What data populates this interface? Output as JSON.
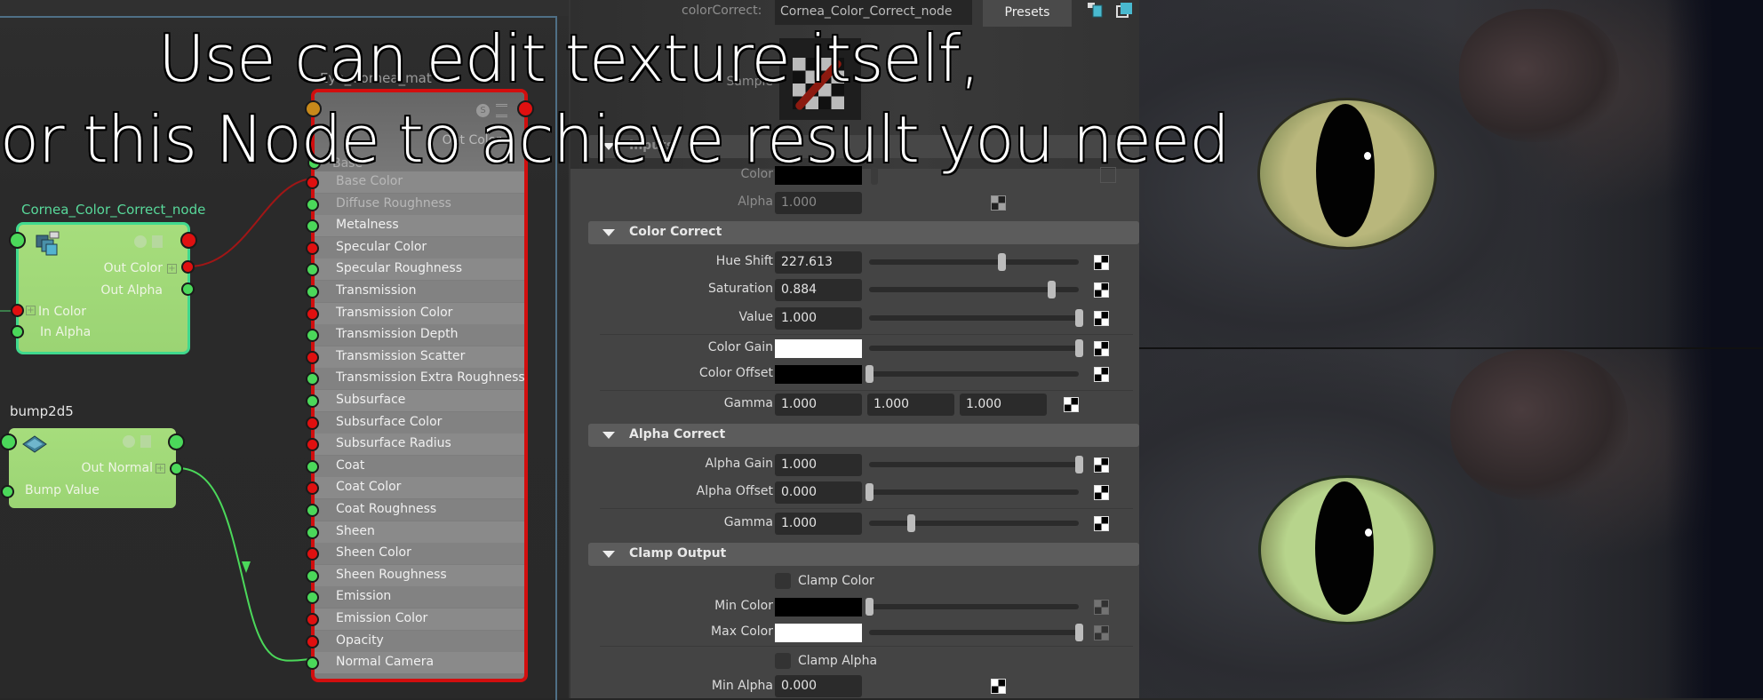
{
  "overlay_caption": {
    "line1": "Use can edit texture itself,",
    "line2": "or this Node to achieve result you need"
  },
  "node_editor": {
    "color_correct_node": {
      "title": "Cornea_Color_Correct_node",
      "icon": "color-correct-node-icon",
      "outputs": [
        "Out Color",
        "Out Alpha"
      ],
      "inputs": [
        "In Color",
        "In Alpha"
      ]
    },
    "bump_node": {
      "title": "bump2d5",
      "icon": "bump-node-icon",
      "outputs": [
        "Out Normal"
      ],
      "inputs": [
        "Bump Value"
      ]
    },
    "material_node": {
      "title": "Eye_Cornea_mat",
      "output_label": "Out Color",
      "first_port_label": "Base",
      "ports": [
        {
          "label": "Base Color",
          "type": "color"
        },
        {
          "label": "Diffuse Roughness",
          "type": "float"
        },
        {
          "label": "Metalness",
          "type": "float"
        },
        {
          "label": "Specular Color",
          "type": "color"
        },
        {
          "label": "Specular Roughness",
          "type": "float"
        },
        {
          "label": "Transmission",
          "type": "float"
        },
        {
          "label": "Transmission Color",
          "type": "color"
        },
        {
          "label": "Transmission Depth",
          "type": "float"
        },
        {
          "label": "Transmission Scatter",
          "type": "color"
        },
        {
          "label": "Transmission Extra Roughness",
          "type": "float"
        },
        {
          "label": "Subsurface",
          "type": "float"
        },
        {
          "label": "Subsurface Color",
          "type": "color"
        },
        {
          "label": "Subsurface Radius",
          "type": "color"
        },
        {
          "label": "Coat",
          "type": "float"
        },
        {
          "label": "Coat Color",
          "type": "color"
        },
        {
          "label": "Coat Roughness",
          "type": "float"
        },
        {
          "label": "Sheen",
          "type": "float"
        },
        {
          "label": "Sheen Color",
          "type": "color"
        },
        {
          "label": "Sheen Roughness",
          "type": "float"
        },
        {
          "label": "Emission",
          "type": "float"
        },
        {
          "label": "Emission Color",
          "type": "color"
        },
        {
          "label": "Opacity",
          "type": "color"
        },
        {
          "label": "Normal Camera",
          "type": "float"
        }
      ]
    },
    "colors": {
      "float_port": "#4bd85a",
      "color_port": "#e01010",
      "selected_border": "#40d98e",
      "material_border": "#d20e0e"
    }
  },
  "attribute_editor": {
    "node_type_label": "colorCorrect:",
    "node_name": "Cornea_Color_Correct_node",
    "presets_label": "Presets",
    "sample_label": "Sample",
    "inputs_section": {
      "title": "Inputs",
      "color_label": "Color",
      "alpha_label": "Alpha",
      "alpha_value": "1.000"
    },
    "color_correct": {
      "title": "Color Correct",
      "hue_shift": {
        "label": "Hue Shift",
        "value": "227.613",
        "slider": 0.63
      },
      "saturation": {
        "label": "Saturation",
        "value": "0.884",
        "slider": 0.87
      },
      "value": {
        "label": "Value",
        "value": "1.000",
        "slider": 1.0
      },
      "color_gain": {
        "label": "Color Gain",
        "color": "#ffffff",
        "slider": 1.0
      },
      "color_offset": {
        "label": "Color Offset",
        "color": "#000000",
        "slider": 0.0
      },
      "gamma": {
        "label": "Gamma",
        "values": [
          "1.000",
          "1.000",
          "1.000"
        ]
      }
    },
    "alpha_correct": {
      "title": "Alpha Correct",
      "alpha_gain": {
        "label": "Alpha Gain",
        "value": "1.000",
        "slider": 1.0
      },
      "alpha_offset": {
        "label": "Alpha Offset",
        "value": "0.000",
        "slider": 0.0
      },
      "gamma": {
        "label": "Gamma",
        "value": "1.000",
        "slider": 0.2
      }
    },
    "clamp_output": {
      "title": "Clamp Output",
      "clamp_color": {
        "label": "Clamp Color",
        "checked": false
      },
      "min_color": {
        "label": "Min Color",
        "color": "#000000",
        "slider": 0.0
      },
      "max_color": {
        "label": "Max Color",
        "color": "#ffffff",
        "slider": 1.0
      },
      "clamp_alpha": {
        "label": "Clamp Alpha",
        "checked": false
      },
      "min_alpha": {
        "label": "Min Alpha",
        "value": "0.000"
      }
    }
  },
  "renders": {
    "top": {
      "description": "cat eye render before color correction",
      "iris_color": "#b9b77c"
    },
    "bottom": {
      "description": "cat eye render after color correction",
      "iris_color": "#b7d48c"
    }
  }
}
